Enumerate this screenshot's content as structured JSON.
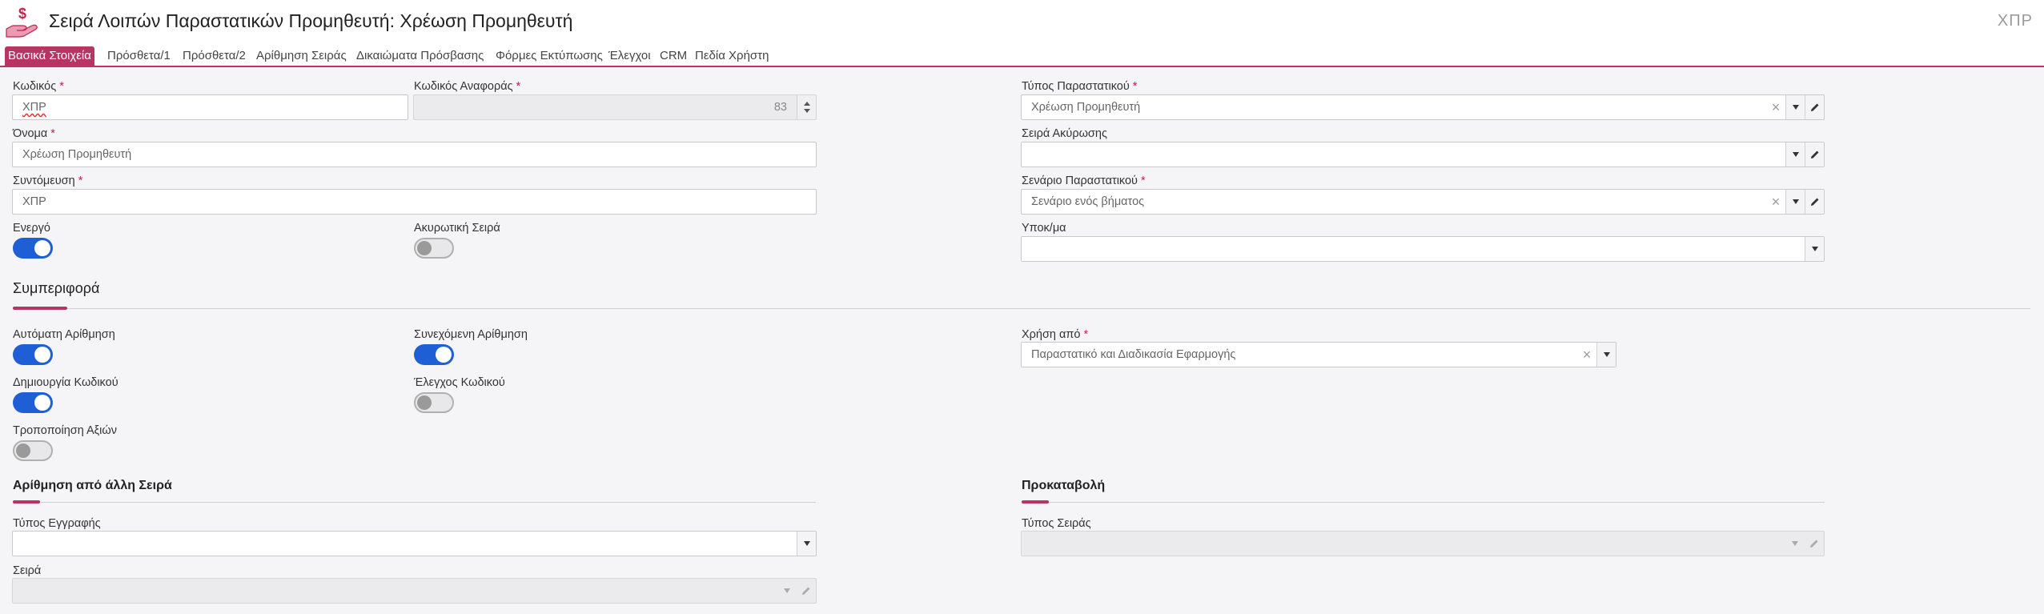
{
  "header": {
    "title": "Σειρά Λοιπών Παραστατικών Προμηθευτή: Χρέωση Προμηθευτή",
    "code": "ΧΠΡ",
    "icon": "hand-money-icon"
  },
  "tabs": [
    {
      "label": "Βασικά Στοιχεία",
      "active": true
    },
    {
      "label": "Πρόσθετα/1"
    },
    {
      "label": "Πρόσθετα/2"
    },
    {
      "label": "Αρίθμηση Σειράς"
    },
    {
      "label": "Δικαιώματα Πρόσβασης"
    },
    {
      "label": "Φόρμες Εκτύπωσης"
    },
    {
      "label": "Έλεγχοι"
    },
    {
      "label": "CRM"
    },
    {
      "label": "Πεδία Χρήστη"
    }
  ],
  "basic": {
    "code_label": "Κωδικός",
    "code_value": "ΧΠΡ",
    "ref_code_label": "Κωδικός Αναφοράς",
    "ref_code_value": "83",
    "name_label": "Όνομα",
    "name_value": "Χρέωση Προμηθευτή",
    "short_label": "Συντόμευση",
    "short_value": "ΧΠΡ",
    "active_label": "Ενεργό",
    "active_on": true,
    "cancel_series_label": "Ακυρωτική Σειρά",
    "cancel_series_on": false,
    "doc_type_label": "Τύπος Παραστατικού",
    "doc_type_value": "Χρέωση Προμηθευτή",
    "cancel_ref_label": "Σειρά Ακύρωσης",
    "cancel_ref_value": "",
    "scenario_label": "Σενάριο Παραστατικού",
    "scenario_value": "Σενάριο ενός βήματος",
    "branch_label": "Υποκ/μα",
    "branch_value": ""
  },
  "behavior": {
    "title": "Συμπεριφορά",
    "auto_num_label": "Αυτόματη Αρίθμηση",
    "auto_num_on": true,
    "continuous_label": "Συνεχόμενη Αρίθμηση",
    "continuous_on": true,
    "create_code_label": "Δημιουργία Κωδικού",
    "create_code_on": true,
    "check_code_label": "Έλεγχος Κωδικού",
    "check_code_on": false,
    "modify_values_label": "Τροποποίηση Αξιών",
    "modify_values_on": false,
    "used_from_label": "Χρήση από",
    "used_from_value": "Παραστατικό και Διαδικασία Εφαρμογής"
  },
  "numbering_other": {
    "title": "Αρίθμηση από άλλη Σειρά",
    "record_type_label": "Τύπος Εγγραφής",
    "record_type_value": "",
    "series_label": "Σειρά",
    "series_value": ""
  },
  "advance": {
    "title": "Προκαταβολή",
    "series_type_label": "Τύπος Σειράς",
    "series_type_value": ""
  },
  "colors": {
    "accent": "#b83463",
    "toggle_on": "#1f5fd6",
    "required": "#c0224e"
  }
}
